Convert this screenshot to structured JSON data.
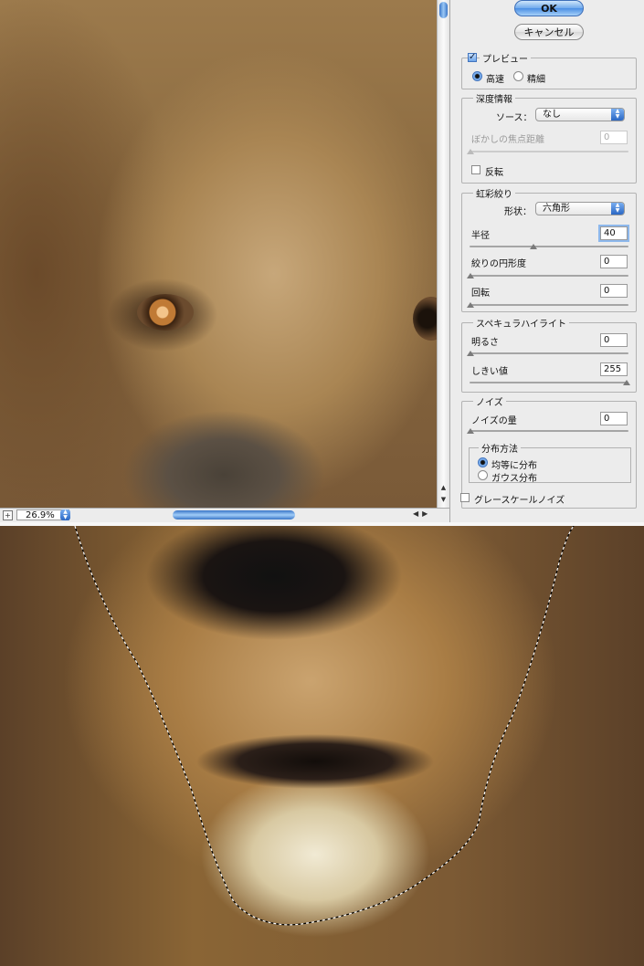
{
  "dialog": {
    "ok_label": "OK",
    "cancel_label": "キャンセル",
    "preview": {
      "label": "プレビュー",
      "checked": true
    },
    "quality": {
      "fast_label": "高速",
      "fine_label": "精細",
      "selected": "高速"
    },
    "depth_map": {
      "title": "深度情報",
      "source_label": "ソース：",
      "source_value": "なし",
      "focal_distance_label": "ぼかしの焦点距離",
      "focal_distance_value": "0",
      "invert_label": "反転"
    },
    "iris": {
      "title": "虹彩絞り",
      "shape_label": "形状：",
      "shape_value": "六角形",
      "radius_label": "半径",
      "radius_value": "40",
      "curvature_label": "絞りの円形度",
      "curvature_value": "0",
      "rotation_label": "回転",
      "rotation_value": "0"
    },
    "specular": {
      "title": "スペキュラハイライト",
      "brightness_label": "明るさ",
      "brightness_value": "0",
      "threshold_label": "しきい値",
      "threshold_value": "255"
    },
    "noise": {
      "title": "ノイズ",
      "amount_label": "ノイズの量",
      "amount_value": "0",
      "distribution_title": "分布方法",
      "uniform_label": "均等に分布",
      "gaussian_label": "ガウス分布",
      "selected_distribution": "均等に分布",
      "monochrome_label": "グレースケールノイズ"
    }
  },
  "preview_window": {
    "zoom_value": "26.9%"
  },
  "colors": {
    "accent": "#4a8ee4",
    "panel_bg": "#ececec"
  },
  "icons": [
    "zoom-in-icon",
    "stepper-icon",
    "scroll-left-arrow-icon",
    "scroll-right-arrow-icon",
    "scroll-up-arrow-icon",
    "scroll-down-arrow-icon"
  ]
}
